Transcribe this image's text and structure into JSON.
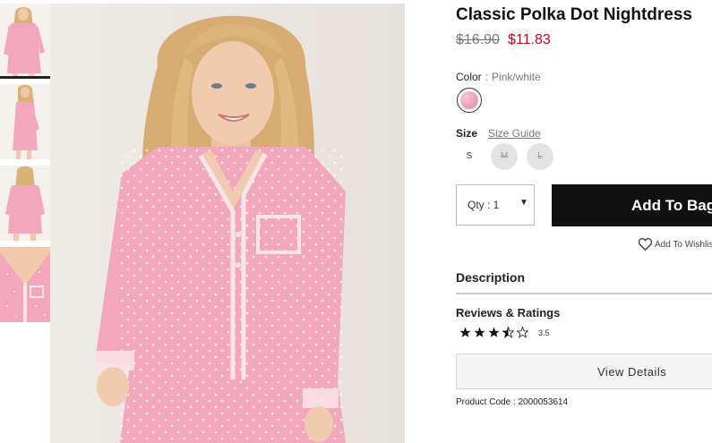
{
  "product": {
    "title": "Classic Polka Dot Nightdress",
    "price_original": "$16.90",
    "price_sale": "$11.83",
    "color_label": "Color",
    "color_separator": ":",
    "color_value": "Pink/white",
    "size_label": "Size",
    "size_guide_label": "Size Guide",
    "sizes": [
      {
        "label": "S",
        "available": true
      },
      {
        "label": "M",
        "available": false
      },
      {
        "label": "L",
        "available": false
      }
    ],
    "qty_label": "Qty : 1",
    "add_button_label": "Add To Bag",
    "wishlist_label": "Add To Wishlist",
    "description_label": "Description",
    "reviews_label": "Reviews & Ratings",
    "rating_value": "3.5",
    "rating_stars": 3.5,
    "view_details_label": "View Details",
    "product_code": "Product Code : 2000053614"
  },
  "gallery": {
    "thumbnails": [
      {
        "icon": "model-front-thumbnail"
      },
      {
        "icon": "model-side-thumbnail"
      },
      {
        "icon": "model-back-thumbnail"
      },
      {
        "icon": "dress-detail-thumbnail"
      }
    ],
    "main_image": "model-wearing-pink-nightdress"
  },
  "colors": {
    "price_sale": "#d0021b",
    "button": "#111111",
    "dress_pink": "#f2a7bd",
    "dot_white": "#ffffff",
    "skin": "#f0c9ad",
    "hair": "#d9b27a"
  }
}
